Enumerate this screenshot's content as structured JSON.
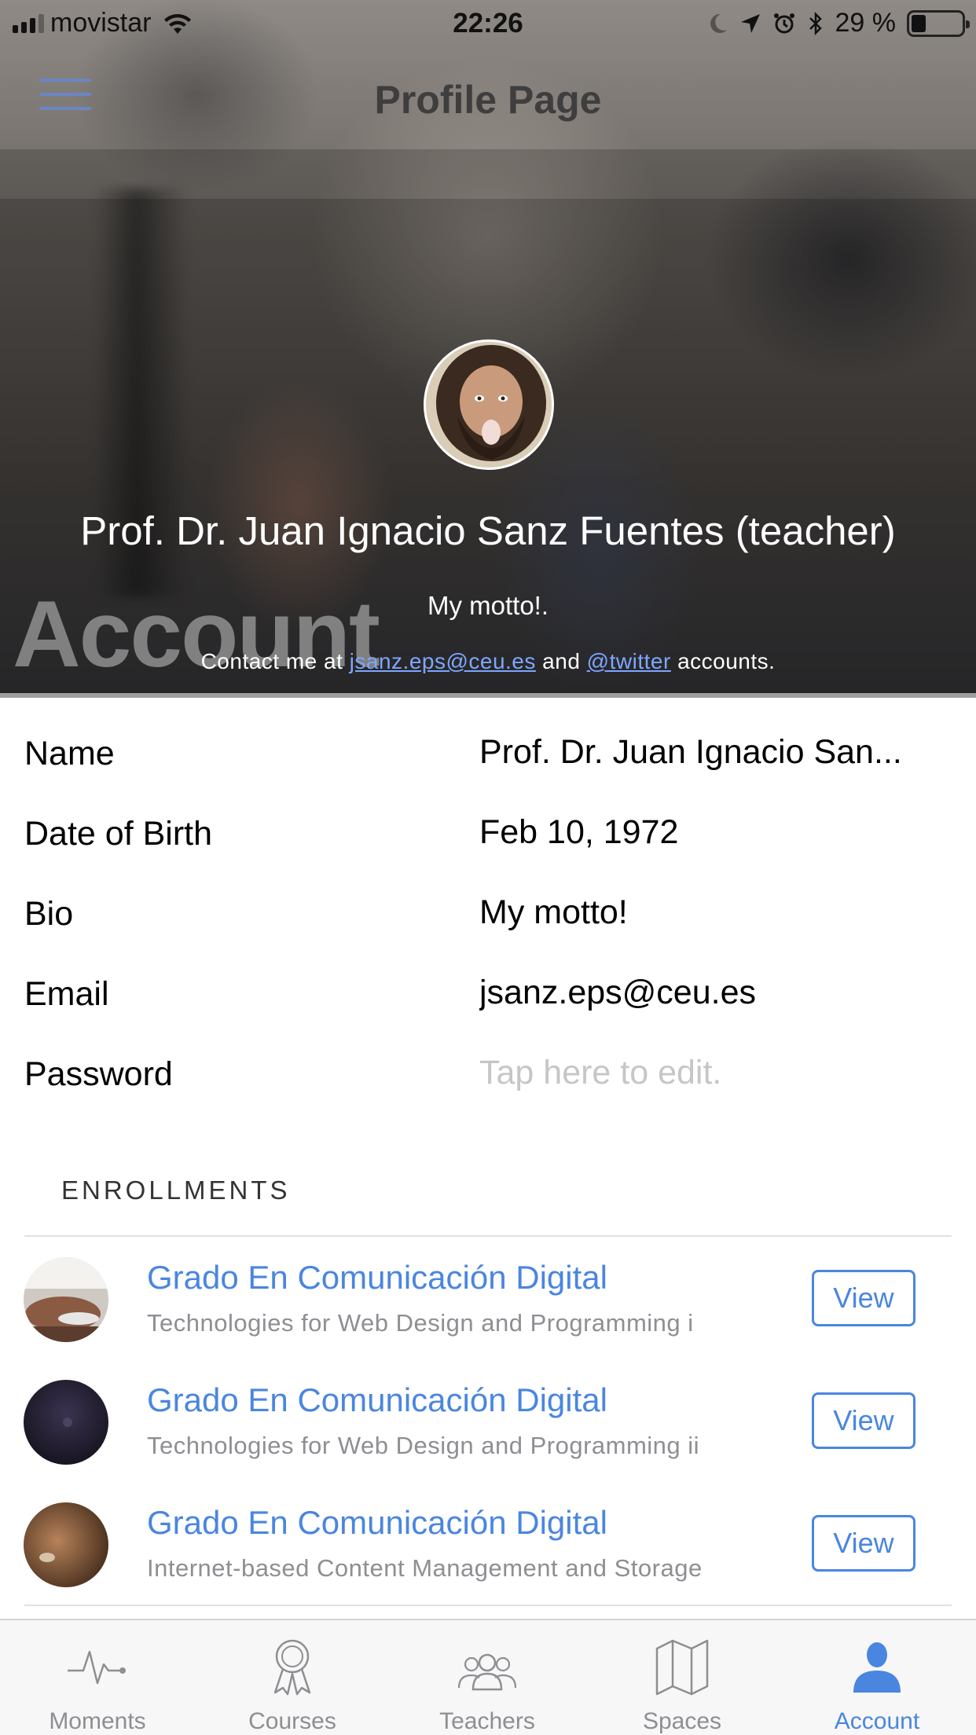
{
  "status_bar": {
    "carrier": "movistar",
    "time": "22:26",
    "battery": "29 %",
    "battery_level": 0.29
  },
  "navbar": {
    "title": "Profile Page"
  },
  "profile": {
    "name": "Prof. Dr. Juan Ignacio Sanz Fuentes (teacher)",
    "watermark": "Account",
    "motto": "My motto!.",
    "contact_prefix": "Contact me at",
    "contact_email": "jsanz.eps@ceu.es",
    "contact_and": "and",
    "contact_twitter": "@twitter",
    "contact_suffix": "accounts."
  },
  "details": [
    {
      "label": "Name",
      "value": "Prof. Dr. Juan Ignacio San..."
    },
    {
      "label": "Date of Birth",
      "value": "Feb 10, 1972"
    },
    {
      "label": "Bio",
      "value": "My motto!"
    },
    {
      "label": "Email",
      "value": "jsanz.eps@ceu.es"
    },
    {
      "label": "Password",
      "value": "Tap here to edit."
    }
  ],
  "enrollments": {
    "header": "ENROLLMENTS",
    "items": [
      {
        "title": "Grado En Comunicación Digital",
        "subtitle": "Technologies for Web Design and Programming i",
        "button": "View"
      },
      {
        "title": "Grado En Comunicación Digital",
        "subtitle": "Technologies for Web Design and Programming ii",
        "button": "View"
      },
      {
        "title": "Grado En Comunicación Digital",
        "subtitle": "Internet-based Content Management and Storage",
        "button": "View"
      }
    ]
  },
  "tabs": [
    {
      "label": "Moments",
      "icon": "pulse-icon",
      "active": false
    },
    {
      "label": "Courses",
      "icon": "award-ribbon-icon",
      "active": false
    },
    {
      "label": "Teachers",
      "icon": "people-group-icon",
      "active": false
    },
    {
      "label": "Spaces",
      "icon": "map-icon",
      "active": false
    },
    {
      "label": "Account",
      "icon": "person-icon",
      "active": true
    }
  ],
  "colors": {
    "accent": "#4a86e0",
    "link": "#7ea6ff",
    "tab_inactive": "#8e8e93",
    "placeholder": "#c6c6c8"
  }
}
